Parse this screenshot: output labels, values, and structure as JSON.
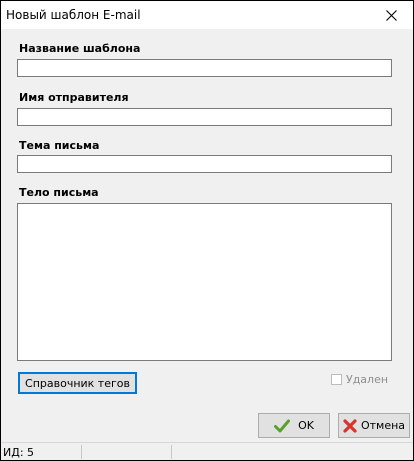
{
  "window": {
    "title": "Новый шаблон E-mail"
  },
  "form": {
    "template_name_label": "Название шаблона",
    "template_name_value": "",
    "sender_name_label": "Имя отправителя",
    "sender_name_value": "",
    "subject_label": "Тема письма",
    "subject_value": "",
    "body_label": "Тело письма",
    "body_value": ""
  },
  "buttons": {
    "tags_reference": "Справочник тегов",
    "ok": "OK",
    "cancel": "Отмена"
  },
  "deleted_checkbox": {
    "label": "Удален",
    "checked": false,
    "enabled": false
  },
  "statusbar": {
    "id_text": "ИД: 5"
  },
  "icons": {
    "close": "close-icon",
    "ok": "checkmark-icon",
    "cancel": "red-x-icon"
  },
  "colors": {
    "ok_check": "#5aa02c",
    "cancel_x": "#d9342b",
    "focus_border": "#0078d7"
  }
}
